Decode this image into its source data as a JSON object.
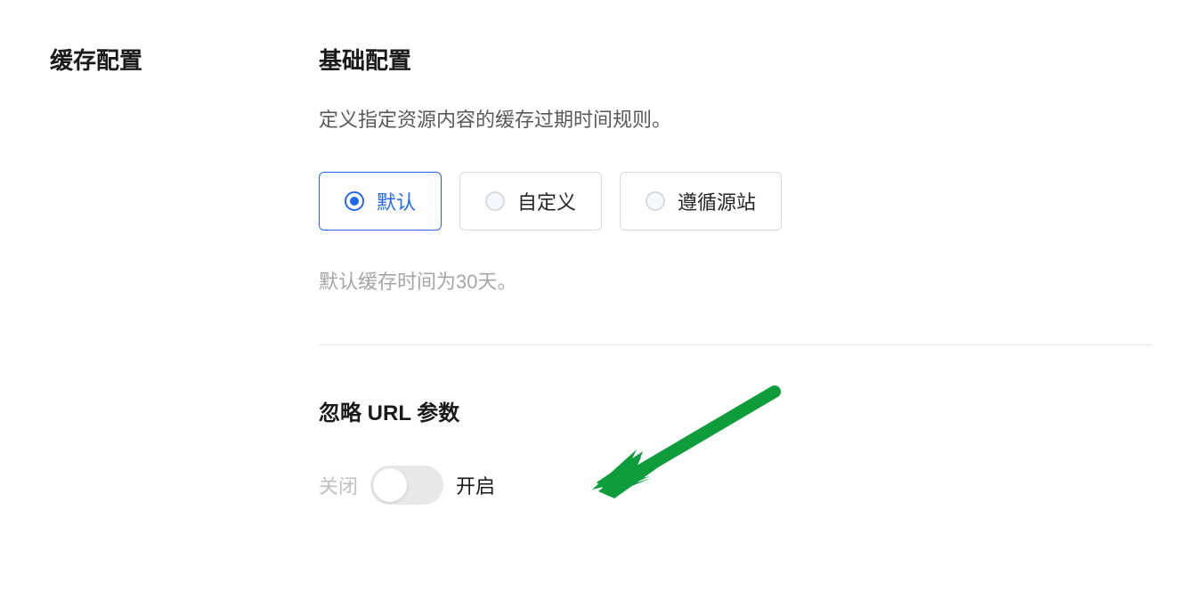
{
  "sidebar": {
    "title": "缓存配置"
  },
  "basic_config": {
    "title": "基础配置",
    "description": "定义指定资源内容的缓存过期时间规则。",
    "options": [
      {
        "label": "默认",
        "selected": true
      },
      {
        "label": "自定义",
        "selected": false
      },
      {
        "label": "遵循源站",
        "selected": false
      }
    ],
    "helper": "默认缓存时间为30天。"
  },
  "ignore_url": {
    "title": "忽略 URL 参数",
    "off_label": "关闭",
    "on_label": "开启",
    "enabled": false
  }
}
